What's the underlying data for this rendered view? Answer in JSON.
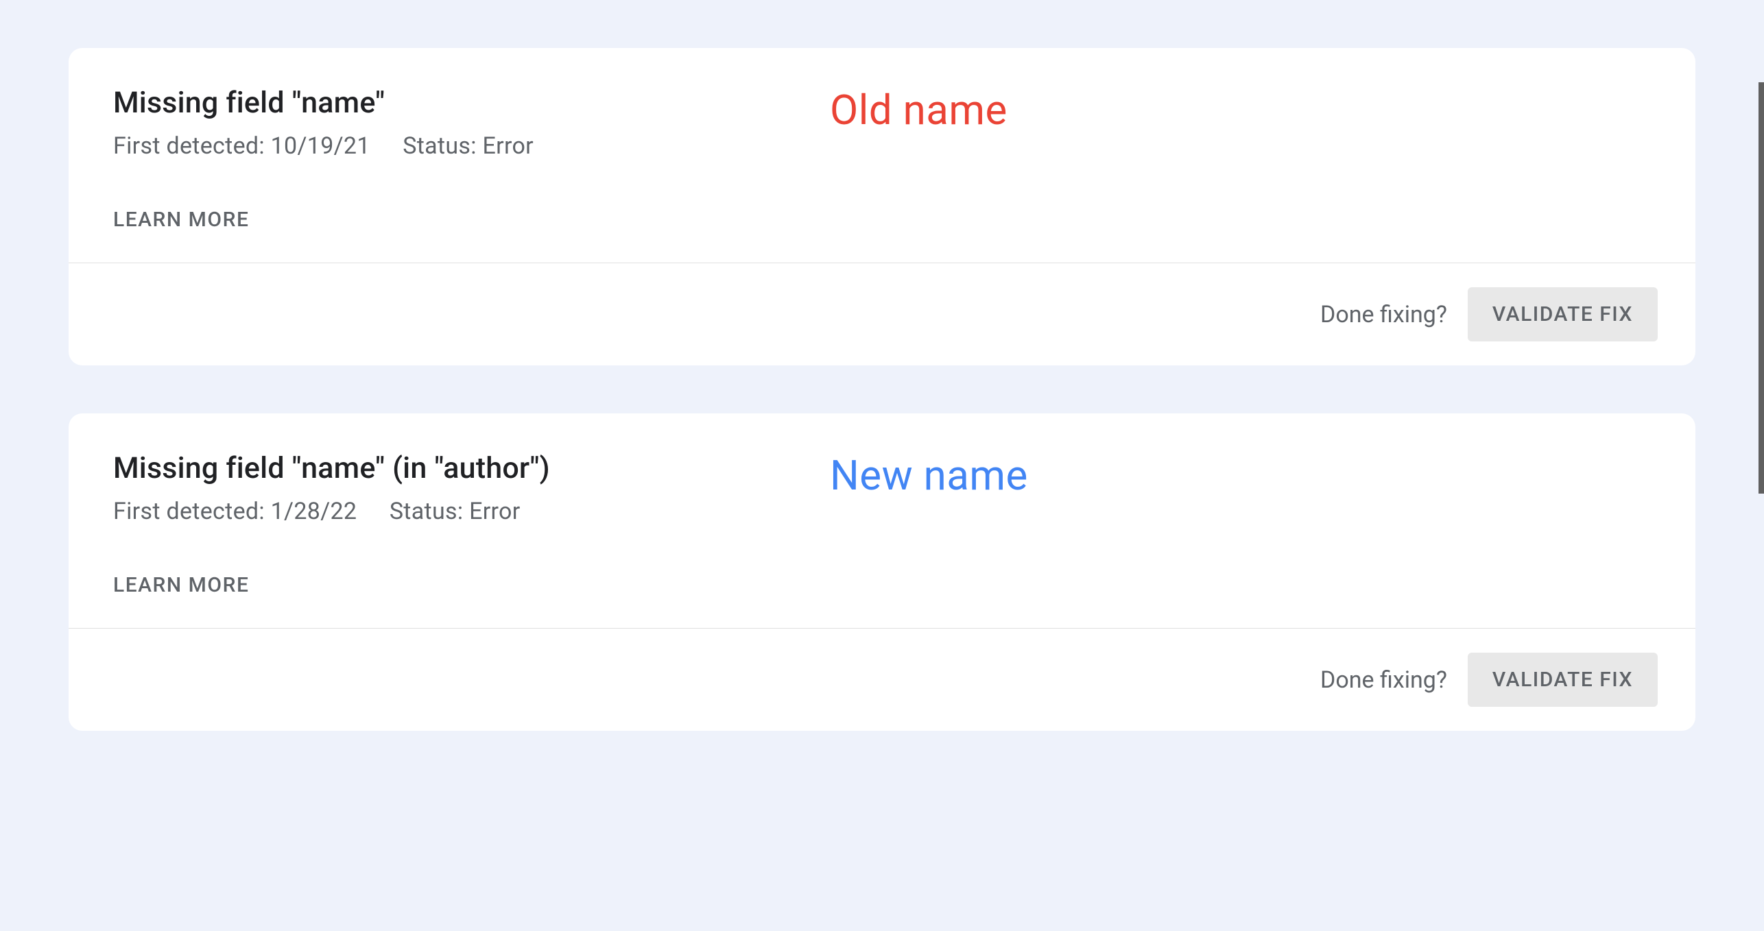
{
  "cards": [
    {
      "title": "Missing field \"name\"",
      "first_detected_label": "First detected:",
      "first_detected_value": "10/19/21",
      "status_label": "Status:",
      "status_value": "Error",
      "annotation_label": "Old name",
      "annotation_class": "old",
      "learn_more_label": "LEARN MORE",
      "done_fixing_label": "Done fixing?",
      "validate_label": "VALIDATE FIX"
    },
    {
      "title": "Missing field \"name\" (in \"author\")",
      "first_detected_label": "First detected:",
      "first_detected_value": "1/28/22",
      "status_label": "Status:",
      "status_value": "Error",
      "annotation_label": "New name",
      "annotation_class": "new",
      "learn_more_label": "LEARN MORE",
      "done_fixing_label": "Done fixing?",
      "validate_label": "VALIDATE FIX"
    }
  ]
}
